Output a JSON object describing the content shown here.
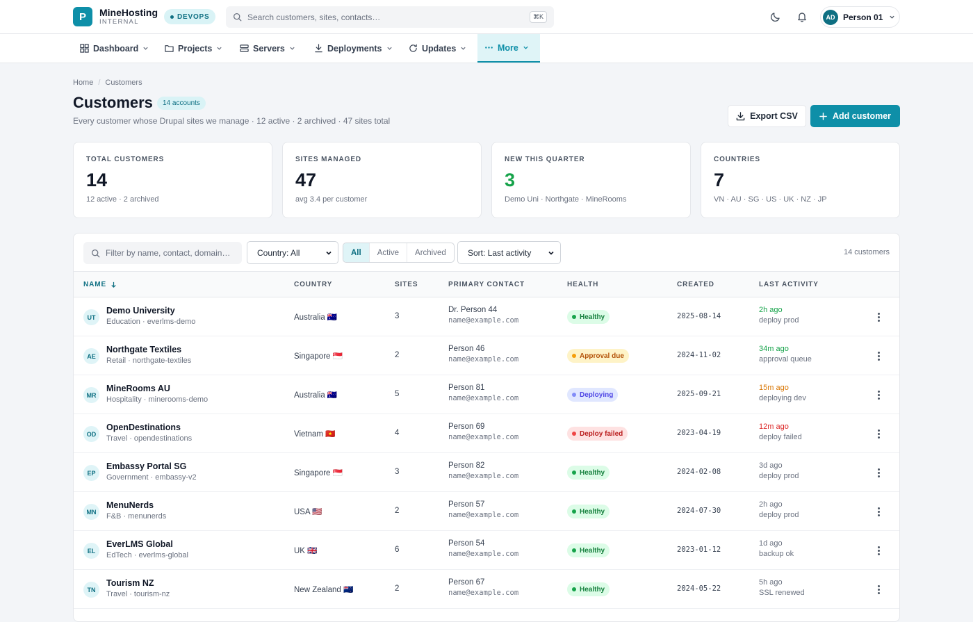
{
  "app": {
    "logo_letter": "P",
    "name": "MineHosting",
    "sub": "INTERNAL",
    "env": "DEVOPS"
  },
  "search": {
    "placeholder": "Search customers, sites, contacts…",
    "shortcut": "⌘K"
  },
  "user": {
    "initials": "AD",
    "name": "Person 01"
  },
  "nav": [
    {
      "label": "Dashboard",
      "icon": "dashboard-icon"
    },
    {
      "label": "Projects",
      "icon": "folder-icon"
    },
    {
      "label": "Servers",
      "icon": "server-icon"
    },
    {
      "label": "Deployments",
      "icon": "download-icon"
    },
    {
      "label": "Updates",
      "icon": "refresh-icon"
    },
    {
      "label": "More",
      "icon": "more-dots-icon",
      "active": true
    }
  ],
  "breadcrumb": {
    "home": "Home",
    "sep": "/",
    "current": "Customers"
  },
  "page": {
    "title": "Customers",
    "count_badge": "14 accounts",
    "subtitle": "Every customer whose Drupal sites we manage · 12 active · 2 archived · 47 sites total",
    "export_label": "Export CSV",
    "add_label": "Add customer"
  },
  "stats": [
    {
      "label": "TOTAL CUSTOMERS",
      "value": "14",
      "sub": "12 active · 2 archived"
    },
    {
      "label": "SITES MANAGED",
      "value": "47",
      "sub": "avg 3.4 per customer"
    },
    {
      "label": "NEW THIS QUARTER",
      "value": "3",
      "sub": "Demo Uni · Northgate · MineRooms",
      "color": "#16a34a"
    },
    {
      "label": "COUNTRIES",
      "value": "7",
      "sub": "VN · AU · SG · US · UK · NZ · JP"
    }
  ],
  "filters": {
    "search_placeholder": "Filter by name, contact, domain…",
    "country": "Country: All",
    "status_tabs": [
      "All",
      "Active",
      "Archived"
    ],
    "sort": "Sort: Last activity",
    "count": "14 customers"
  },
  "columns": [
    "NAME",
    "COUNTRY",
    "SITES",
    "PRIMARY CONTACT",
    "HEALTH",
    "CREATED",
    "LAST ACTIVITY"
  ],
  "rows": [
    {
      "initials": "UT",
      "name": "Demo University",
      "sub": "Education · everlms-demo",
      "country": "Australia 🇦🇺",
      "sites": "3",
      "contact": "Dr. Person 44",
      "email": "name@example.com",
      "health": "Healthy",
      "health_type": "healthy",
      "created": "2025-08-14",
      "ago": "2h ago",
      "ago_type": "green",
      "activity": "deploy prod"
    },
    {
      "initials": "AE",
      "name": "Northgate Textiles",
      "sub": "Retail · northgate-textiles",
      "country": "Singapore 🇸🇬",
      "sites": "2",
      "contact": "Person 46",
      "email": "name@example.com",
      "health": "Approval due",
      "health_type": "approval",
      "created": "2024-11-02",
      "ago": "34m ago",
      "ago_type": "green",
      "activity": "approval queue"
    },
    {
      "initials": "MR",
      "name": "MineRooms AU",
      "sub": "Hospitality · minerooms-demo",
      "country": "Australia 🇦🇺",
      "sites": "5",
      "contact": "Person 81",
      "email": "name@example.com",
      "health": "Deploying",
      "health_type": "deploying",
      "created": "2025-09-21",
      "ago": "15m ago",
      "ago_type": "orange",
      "activity": "deploying dev"
    },
    {
      "initials": "OD",
      "name": "OpenDestinations",
      "sub": "Travel · opendestinations",
      "country": "Vietnam 🇻🇳",
      "sites": "4",
      "contact": "Person 69",
      "email": "name@example.com",
      "health": "Deploy failed",
      "health_type": "failed",
      "created": "2023-04-19",
      "ago": "12m ago",
      "ago_type": "red",
      "activity": "deploy failed"
    },
    {
      "initials": "EP",
      "name": "Embassy Portal SG",
      "sub": "Government · embassy-v2",
      "country": "Singapore 🇸🇬",
      "sites": "3",
      "contact": "Person 82",
      "email": "name@example.com",
      "health": "Healthy",
      "health_type": "healthy",
      "created": "2024-02-08",
      "ago": "3d ago",
      "ago_type": "gray",
      "activity": "deploy prod"
    },
    {
      "initials": "MN",
      "name": "MenuNerds",
      "sub": "F&B · menunerds",
      "country": "USA 🇺🇸",
      "sites": "2",
      "contact": "Person 57",
      "email": "name@example.com",
      "health": "Healthy",
      "health_type": "healthy",
      "created": "2024-07-30",
      "ago": "2h ago",
      "ago_type": "gray",
      "activity": "deploy prod"
    },
    {
      "initials": "EL",
      "name": "EverLMS Global",
      "sub": "EdTech · everlms-global",
      "country": "UK 🇬🇧",
      "sites": "6",
      "contact": "Person 54",
      "email": "name@example.com",
      "health": "Healthy",
      "health_type": "healthy",
      "created": "2023-01-12",
      "ago": "1d ago",
      "ago_type": "gray",
      "activity": "backup ok"
    },
    {
      "initials": "TN",
      "name": "Tourism NZ",
      "sub": "Travel · tourism-nz",
      "country": "New Zealand 🇳🇿",
      "sites": "2",
      "contact": "Person 67",
      "email": "name@example.com",
      "health": "Healthy",
      "health_type": "healthy",
      "created": "2024-05-22",
      "ago": "5h ago",
      "ago_type": "gray",
      "activity": "SSL renewed"
    }
  ]
}
